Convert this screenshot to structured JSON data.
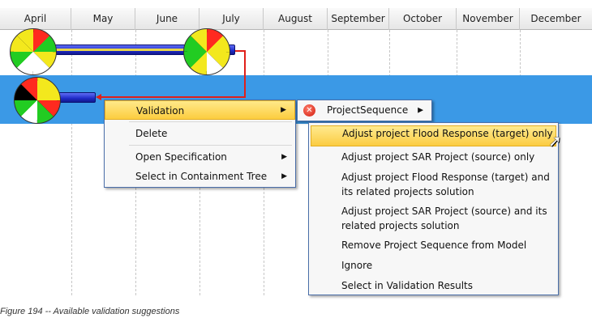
{
  "timeline": {
    "months": [
      "April",
      "May",
      "June",
      "July",
      "August",
      "September",
      "October",
      "November",
      "December"
    ]
  },
  "context_menu": {
    "items": [
      {
        "label": "Validation",
        "has_submenu": true
      },
      {
        "label": "Delete",
        "has_submenu": false
      },
      {
        "label": "Open Specification",
        "has_submenu": true
      },
      {
        "label": "Select in Containment Tree",
        "has_submenu": true
      }
    ]
  },
  "validation_submenu": {
    "item_label": "ProjectSequence",
    "icon": "error-icon"
  },
  "suggestions_menu": {
    "items": [
      "Adjust project Flood Response (target) only",
      "Adjust project SAR Project (source) only",
      "Adjust project Flood Response (target) and its related projects solution",
      "Adjust project SAR Project (source) and its related projects solution",
      "Remove Project Sequence from Model",
      "Ignore",
      "Select in Validation Results"
    ]
  },
  "caption": "Figure 194 -- Available validation suggestions",
  "colors": {
    "selection_row": "#3b99e6",
    "menu_highlight": "#fbcc42",
    "dependency_arrow": "#e0201a",
    "bar": "#1f2bc7"
  }
}
